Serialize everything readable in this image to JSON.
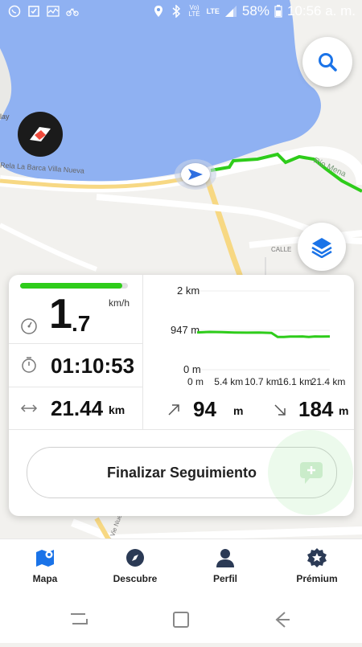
{
  "status_bar": {
    "battery": "58%",
    "time": "10:56 a. m.",
    "network": "LTE",
    "volte": "Vo) LTE"
  },
  "map": {
    "road_labels": [
      "Río Mena",
      "Rela La Barca Villa Nueva",
      "CALLE",
      "era Vie Nueva",
      "lay"
    ]
  },
  "stats": {
    "speed_integer": "1",
    "speed_decimal": ".7",
    "speed_unit": "km/h",
    "progress_fraction": 0.95,
    "time": "01:10:53",
    "distance_value": "21.44",
    "distance_unit": "km",
    "ascent_value": "94",
    "ascent_unit": "m",
    "descent_value": "184",
    "descent_unit": "m"
  },
  "chart_data": {
    "type": "line",
    "y_tick_labels": [
      "2 km",
      "947 m",
      "0 m"
    ],
    "x_tick_labels": [
      "0 m",
      "5.4 km",
      "10.7 km",
      "16.1 km",
      "21.4 km"
    ],
    "x": [
      0,
      2,
      4,
      6,
      8,
      10,
      12,
      13,
      14,
      15,
      16,
      17,
      18,
      19,
      20,
      21.4
    ],
    "values": [
      947,
      960,
      955,
      945,
      940,
      945,
      935,
      830,
      830,
      840,
      840,
      845,
      830,
      845,
      840,
      845
    ],
    "ylim": [
      0,
      2000
    ],
    "xlim": [
      0,
      21.4
    ],
    "color": "#2ecc1a"
  },
  "actions": {
    "finalize_label": "Finalizar Seguimiento"
  },
  "bottom_nav": [
    {
      "label": "Mapa",
      "icon": "map-icon",
      "active": true
    },
    {
      "label": "Descubre",
      "icon": "compass-icon"
    },
    {
      "label": "Perfil",
      "icon": "person-icon"
    },
    {
      "label": "Prémium",
      "icon": "premium-badge-icon"
    }
  ],
  "colors": {
    "accent": "#1a73e8",
    "track": "#2ecc1a",
    "water": "#8fb1f2"
  }
}
